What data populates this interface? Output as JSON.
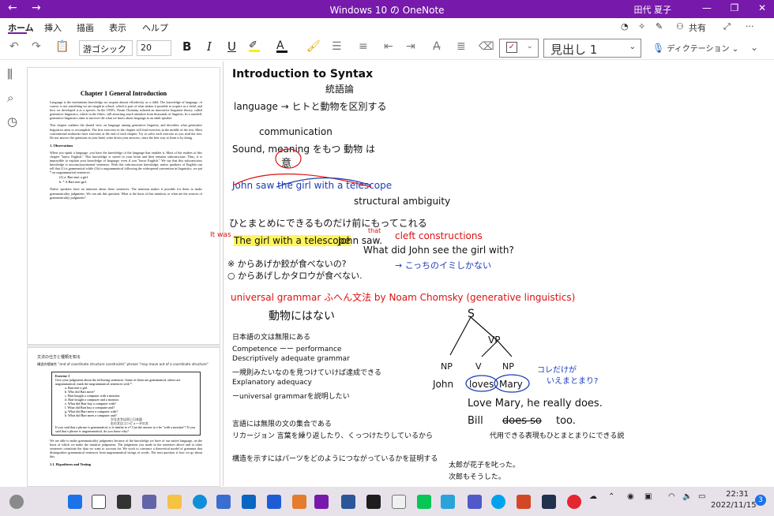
{
  "window": {
    "title": "Windows 10 の OneNote",
    "user": "田代 夏子",
    "back": "←",
    "forward": "→",
    "minimize": "—",
    "maximize": "❐",
    "close": "✕"
  },
  "menu": {
    "tabs": [
      "ホーム",
      "挿入",
      "描画",
      "表示",
      "ヘルプ"
    ],
    "share": "共有"
  },
  "toolbar": {
    "font_name": "游ゴシック",
    "font_size": "20",
    "bold": "B",
    "italic": "I",
    "underline": "U",
    "style": "見出し 1",
    "dictate": "ディクテーション"
  },
  "document": {
    "chapter_title": "Chapter 1     General Introduction",
    "para1": "Language is the mechanism knowledge we acquire almost effortlessly as a child. The knowledge of language, of course, is not something we are taught in school, which is part of what makes it possible to acquire as a child, and how we developed it as a species. In the 1950's, Noam Chomsky ushered an innovative linguistic theory, called generative linguistics, which in the fifties, still attracting much attention from thousands of linguists. In a nutshell, generative linguistics aims to uncover the what we know about language as an adult speaker.",
    "para2": "This chapter outlines the shared view on language among generative linguists, and describes what generative linguistics aims to accomplish. The first exercises in the chapter will find exercises in the middle of the text. Most conventional textbooks have exercises at the end of each chapter. Try to solve each exercise as you read the text. Do not answer the questions in your head; write down your answers, since the best way to learn is by doing.",
    "sec1": "1.     Observations",
    "para3": "When you speak a language, you have the knowledge of the language that enables it. Most of the readers of this chapter \"know English.\" This knowledge is stored in your brain and then remains subconscious. Thus, it is impossible to explain your knowledge of language, even if you \"know English.\" We say that this subconscious knowledge is unconscious/mental sentences. With this subconscious knowledge, native speakers of English can tell that (1) is grammatical while (1b) is ungrammatical following the widespread convention in linguistics, we put * on ungrammatical sentences.",
    "ex1a": "(1)   a.     Bart met a girl.",
    "ex1b": "         b.   * A Bart met girl.",
    "para4": "Native speakers have an intuition about these sentences. The intuition makes it possible for them to make grammaticality judgments. We can ask this question. What is the basis of this intuition, or what are the sources of grammaticality judgments?",
    "p2_head": "文法の仕方と種類を知る",
    "p2_sub": "構造的曖昧性 \"and of coordinate structure constraints\" phrase \"may move out of a coordinate structure\"",
    "ex_title": "Exercise 1",
    "ex_intro": "Give your judgments about the following sentences. Some of them are grammatical, others are ungrammatical; mark the ungrammatical sentences with *.",
    "ex_items": [
      "a.   Bart met a girl.",
      "b.   Who did Bart meet?",
      "c.   Bart bought a computer with a monitor.",
      "d.   Bart bought a computer and a monitor.",
      "e.   What did Bart buy a computer with?",
      "f.   What did Bart buy a computer and?",
      "g.   What did Bart meet a computer with?",
      "h.   What did Bart meet a computer and?"
    ],
    "ex_note1": "かな文字は同じ日本語",
    "ex_note2": "右の文はコンピュータの文",
    "ex_outro": "If you said that a phrase is grammatical, is it similar to e? Can the answer to e be \"with a monitor\"? If you said that e phrase is ungrammatical, do you know why?",
    "para5": "We are able to make grammaticality judgments because of the knowledge we have of our native language, on the basis of which we make the intuitive judgments. The judgments you made in the sentences above and to other sentences constitute the data we want to account for. We work to construct a theoretical model of grammar that distinguishes grammatical sentences from ungrammatical strings of words. The next question is how we go about this.",
    "sec2": "1.1.     Hypotheses and Testing"
  },
  "notes": {
    "title": "Introduction to Syntax",
    "title_jp": "統語論",
    "language_line": "language → ヒトと動物を区別する",
    "communication": "communication",
    "sound_meaning": "Sound, meaning をもつ  動物 は",
    "i_kanji": "意",
    "john_saw": "John saw the girl with a telescope",
    "structural": "structural ambiguity",
    "hitomatome": "ひとまとめにできるものだけ前にもってこれる",
    "it_was": "It was",
    "that": "that",
    "girl_telescope": "The girl with a telescope",
    "john_saw2": "John saw.",
    "cleft": "cleft constructions",
    "what_did": "What did John see the girl with?",
    "star_line": "※ からあげか餃が食べないの?",
    "maru_line": "○ からあげしかタロウが食べない.",
    "kochira": "→ こっちのイミしかない",
    "universal": "universal grammar ふへん文法 by Noam Chomsky (generative linguistics)",
    "doubutsu": "動物にはない",
    "jp1": "日本語の文は無限にある",
    "jp2": "Competence  ーー  performance",
    "jp3": "Descriptively adequate grammar",
    "jp4": "一規則みたいなのを見つけていけば達成できる",
    "jp5": "Explanatory adequacy",
    "jp6": "ーuniversal grammarを説明したい",
    "jp7": "言語には無限の文の集合である",
    "jp8": "リカージョン  言葉を繰り返したり、くっつけたりしているから",
    "jp9": "構造を示すにはパーツをどのようにつながっているかを証明する",
    "tree_s": "S",
    "tree_vp": "VP",
    "tree_np1": "NP",
    "tree_v": "V",
    "tree_np2": "NP",
    "tree_john": "John",
    "tree_loves": "loves",
    "tree_mary": "Mary",
    "kore": "コレだけが",
    "iemakeru": "いえまとまり?",
    "love_mary": "Love Mary, he really does.",
    "bill": "Bill",
    "does_so": "does so",
    "too": "too.",
    "daiyou": "代用できる表現もひとまとまりにできる説",
    "taro1": "太郎が花子を叱った。",
    "taro2": "次郎もそうした。"
  },
  "taskbar": {
    "time": "22:31",
    "date": "2022/11/15",
    "badge": "3"
  }
}
